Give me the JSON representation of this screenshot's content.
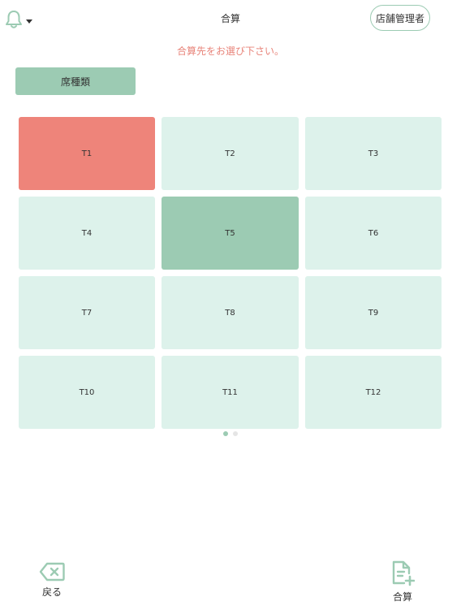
{
  "header": {
    "title": "合算",
    "manager_label": "店舗管理者",
    "bell_icon": "bell-icon",
    "caret_icon": "caret-down-icon"
  },
  "instruction": "合算先をお選び下さい。",
  "seat_type_label": "席種類",
  "tables": [
    {
      "label": "T1",
      "state": "selected-red"
    },
    {
      "label": "T2",
      "state": "normal"
    },
    {
      "label": "T3",
      "state": "normal"
    },
    {
      "label": "T4",
      "state": "normal"
    },
    {
      "label": "T5",
      "state": "selected-green"
    },
    {
      "label": "T6",
      "state": "normal"
    },
    {
      "label": "T7",
      "state": "normal"
    },
    {
      "label": "T8",
      "state": "normal"
    },
    {
      "label": "T9",
      "state": "normal"
    },
    {
      "label": "T10",
      "state": "normal"
    },
    {
      "label": "T11",
      "state": "normal"
    },
    {
      "label": "T12",
      "state": "normal"
    }
  ],
  "pager": {
    "pages": 2,
    "active": 0
  },
  "footer": {
    "back_label": "戻る",
    "merge_label": "合算",
    "back_icon": "backspace-icon",
    "merge_icon": "document-add-icon"
  },
  "colors": {
    "accent": "#9ccbb3",
    "cell": "#ddf2eb",
    "red": "#ee847a",
    "instruction": "#e8847a"
  }
}
